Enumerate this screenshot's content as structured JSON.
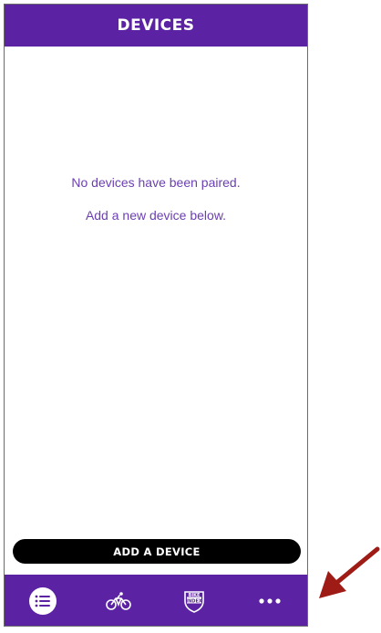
{
  "header": {
    "title": "DEVICES"
  },
  "empty_state": {
    "line1": "No devices have been paired.",
    "line2": "Add a new device below."
  },
  "add_device_button": {
    "label": "ADD A DEVICE"
  },
  "bottom_nav": {
    "items": [
      {
        "icon": "list-icon",
        "active": true
      },
      {
        "icon": "bike-icon",
        "active": false
      },
      {
        "icon": "bike-index-shield-icon",
        "label": "BIKE INDEX",
        "active": false
      },
      {
        "icon": "more-icon",
        "active": false
      }
    ]
  },
  "colors": {
    "brand_purple": "#5b23a3",
    "text_purple": "#6b3fb0",
    "button_black": "#000000",
    "arrow_red": "#9e1b16"
  }
}
